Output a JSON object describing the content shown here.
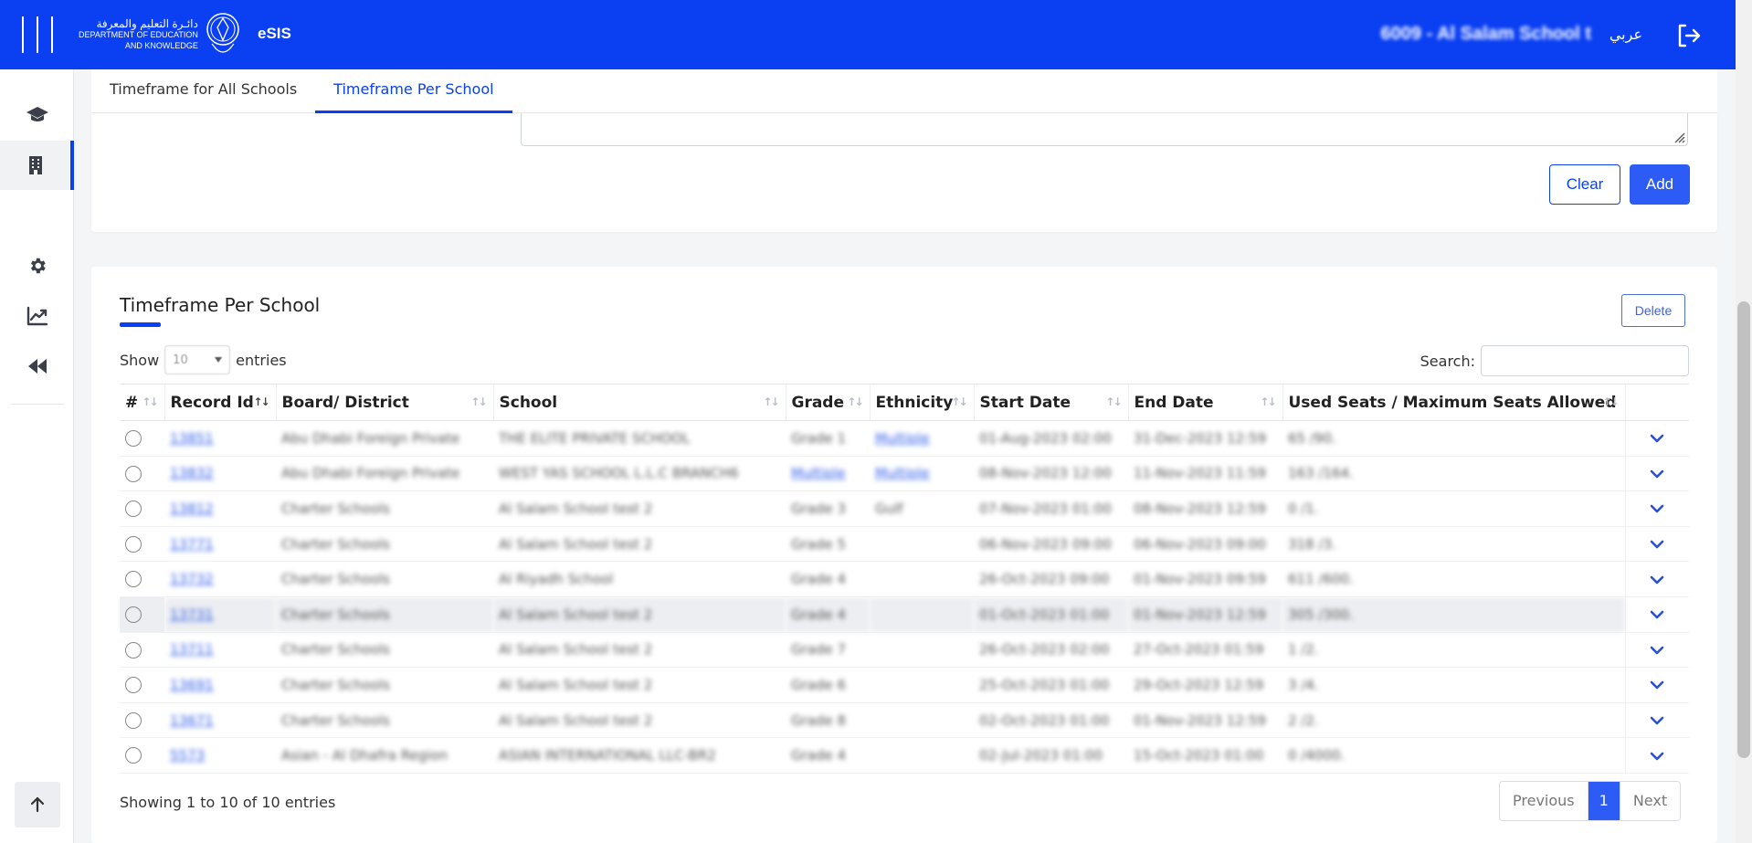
{
  "header": {
    "logo_ar": "دائـرة التعليم والمعرفة",
    "logo_en_line1": "DEPARTMENT OF EDUCATION",
    "logo_en_line2": "AND KNOWLEDGE",
    "app_name": "eSIS",
    "school": "6009 - Al Salam School t",
    "language": "عربي",
    "colors": {
      "bar": "#0a3ff2",
      "accent": "#2d5bf5"
    }
  },
  "sidebar": {
    "items": [
      {
        "icon": "graduation-cap-icon"
      },
      {
        "icon": "building-icon",
        "active": true
      },
      {
        "icon": "gear-icon"
      },
      {
        "icon": "chart-line-icon"
      },
      {
        "icon": "rewind-icon"
      }
    ],
    "scroll_top_icon": "arrow-up-icon"
  },
  "tabs": [
    {
      "label": "Timeframe for All Schools",
      "active": false
    },
    {
      "label": "Timeframe Per School",
      "active": true
    }
  ],
  "form": {
    "clear_label": "Clear",
    "add_label": "Add"
  },
  "table_card": {
    "title": "Timeframe Per School",
    "delete_label": "Delete",
    "show_label": "Show",
    "entries_label": "entries",
    "page_length": "10",
    "search_label": "Search:",
    "search_value": "",
    "columns": [
      "#",
      "Record Id",
      "Board/ District",
      "School",
      "Grade",
      "Ethnicity",
      "Start Date",
      "End Date",
      "Used Seats / Maximum Seats Allowed"
    ],
    "rows": [
      {
        "id": "13851",
        "board": "Abu Dhabi Foreign Private",
        "school": "THE ELITE PRIVATE SCHOOL",
        "grade": "Grade 1",
        "ethnicity": "Multiple",
        "start": "01-Aug-2023 02:00",
        "end": "31-Dec-2023 12:59",
        "seats": "65 /90."
      },
      {
        "id": "13832",
        "board": "Abu Dhabi Foreign Private",
        "school": "WEST YAS SCHOOL L.L.C BRANCH6",
        "grade": "Multiple",
        "ethnicity": "Multiple",
        "start": "08-Nov-2023 12:00",
        "end": "11-Nov-2023 11:59",
        "seats": "163 /164."
      },
      {
        "id": "13812",
        "board": "Charter Schools",
        "school": "Al Salam School test 2",
        "grade": "Grade 3",
        "ethnicity": "Gulf",
        "start": "07-Nov-2023 01:00",
        "end": "08-Nov-2023 12:59",
        "seats": "0 /1."
      },
      {
        "id": "13771",
        "board": "Charter Schools",
        "school": "Al Salam School test 2",
        "grade": "Grade 5",
        "ethnicity": "",
        "start": "06-Nov-2023 09:00",
        "end": "06-Nov-2023 09:00",
        "seats": "318 /3."
      },
      {
        "id": "13732",
        "board": "Charter Schools",
        "school": "Al Riyadh School",
        "grade": "Grade 4",
        "ethnicity": "",
        "start": "26-Oct-2023 09:00",
        "end": "01-Nov-2023 09:59",
        "seats": "611 /600."
      },
      {
        "id": "13731",
        "board": "Charter Schools",
        "school": "Al Salam School test 2",
        "grade": "Grade 4",
        "ethnicity": "",
        "start": "01-Oct-2023 01:00",
        "end": "01-Nov-2023 12:59",
        "seats": "305 /300.",
        "highlight": true
      },
      {
        "id": "13711",
        "board": "Charter Schools",
        "school": "Al Salam School test 2",
        "grade": "Grade 7",
        "ethnicity": "",
        "start": "26-Oct-2023 02:00",
        "end": "27-Oct-2023 01:59",
        "seats": "1 /2."
      },
      {
        "id": "13691",
        "board": "Charter Schools",
        "school": "Al Salam School test 2",
        "grade": "Grade 6",
        "ethnicity": "",
        "start": "25-Oct-2023 01:00",
        "end": "29-Oct-2023 12:59",
        "seats": "3 /4."
      },
      {
        "id": "13671",
        "board": "Charter Schools",
        "school": "Al Salam School test 2",
        "grade": "Grade 8",
        "ethnicity": "",
        "start": "02-Oct-2023 01:00",
        "end": "01-Nov-2023 12:59",
        "seats": "2 /2."
      },
      {
        "id": "5573",
        "board": "Asian - Al Dhafra Region",
        "school": "ASIAN INTERNATIONAL LLC-BR2",
        "grade": "Grade 4",
        "ethnicity": "",
        "start": "02-Jul-2023 01:00",
        "end": "15-Oct-2023 01:00",
        "seats": "0 /4000."
      }
    ],
    "info": "Showing 1 to 10 of 10 entries",
    "pagination": {
      "previous": "Previous",
      "current": "1",
      "next": "Next"
    }
  }
}
